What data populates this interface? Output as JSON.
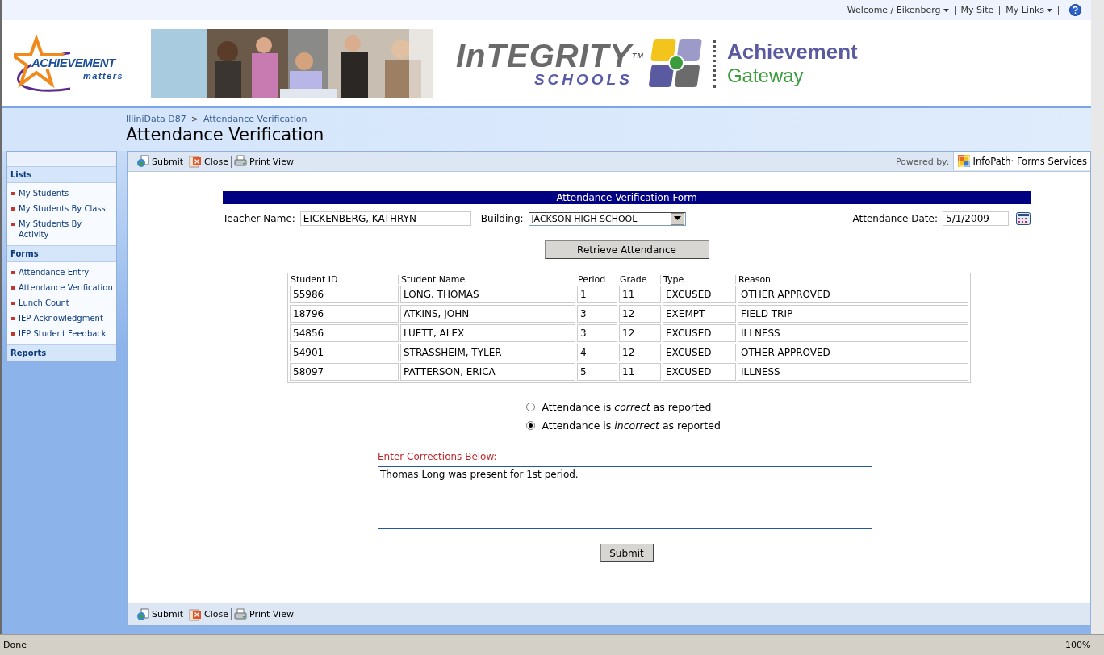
{
  "top_bar": {
    "welcome": "Welcome / Eikenberg",
    "links": [
      "My Site",
      "My Links"
    ]
  },
  "banner": {
    "logo_left": {
      "title": "ACHIEVEMENT",
      "subtitle": "matters"
    },
    "logo_right": {
      "title": "InTEGRITY",
      "trademark": "TM",
      "subtitle": "SCHOOLS"
    },
    "tagline": [
      "Achievement",
      "Gateway"
    ]
  },
  "breadcrumb": [
    "IlliniData D87",
    "Attendance Verification"
  ],
  "breadcrumb_separator": ">",
  "page_title": "Attendance Verification",
  "sidebar": [
    {
      "heading": "Lists",
      "items": [
        "My Students",
        "My Students By Class",
        "My Students By Activity"
      ]
    },
    {
      "heading": "Forms",
      "items": [
        "Attendance Entry",
        "Attendance Verification",
        "Lunch Count",
        "IEP Acknowledgment",
        "IEP Student Feedback"
      ]
    },
    {
      "heading": "Reports"
    }
  ],
  "toolbar": {
    "buttons": [
      {
        "kind": "submit",
        "label": "Submit"
      },
      {
        "kind": "close",
        "label": "Close"
      },
      {
        "kind": "print",
        "label": "Print View"
      }
    ],
    "powered_by": "Powered by:",
    "brand": "InfoPath· Forms Services"
  },
  "form": {
    "title": "Attendance Verification Form",
    "teacher": {
      "label": "Teacher Name:",
      "value": "EICKENBERG, KATHRYN"
    },
    "building": {
      "label": "Building:",
      "value": "JACKSON HIGH SCHOOL"
    },
    "date": {
      "label": "Attendance Date:",
      "value": "5/1/2009"
    },
    "retrieve_button": "Retrieve Attendance",
    "table": {
      "columns": [
        "Student ID",
        "Student Name",
        "Period",
        "Grade",
        "Type",
        "Reason"
      ],
      "rows": [
        [
          "55986",
          "LONG, THOMAS",
          "1",
          "11",
          "EXCUSED",
          "OTHER APPROVED"
        ],
        [
          "18796",
          "ATKINS, JOHN",
          "3",
          "12",
          "EXEMPT",
          "FIELD TRIP"
        ],
        [
          "54856",
          "LUETT, ALEX",
          "3",
          "12",
          "EXCUSED",
          "ILLNESS"
        ],
        [
          "54901",
          "STRASSHEIM, TYLER",
          "4",
          "12",
          "EXCUSED",
          "OTHER APPROVED"
        ],
        [
          "58097",
          "PATTERSON, ERICA",
          "5",
          "11",
          "EXCUSED",
          "ILLNESS"
        ]
      ]
    },
    "options": [
      {
        "label": "Attendance is *correct* as reported",
        "selected": false
      },
      {
        "label": "Attendance is *incorrect* as reported",
        "selected": true
      }
    ],
    "corrections_label": "Enter Corrections Below:",
    "corrections": "Thomas Long was present for 1st period.",
    "submit_button": "Submit"
  },
  "bottom_toolbar": [
    {
      "kind": "submit",
      "label": "Submit"
    },
    {
      "kind": "close",
      "label": "Close"
    },
    {
      "kind": "print",
      "label": "Print View"
    }
  ],
  "status_bar": {
    "status": "Done",
    "zoom": "100%"
  }
}
